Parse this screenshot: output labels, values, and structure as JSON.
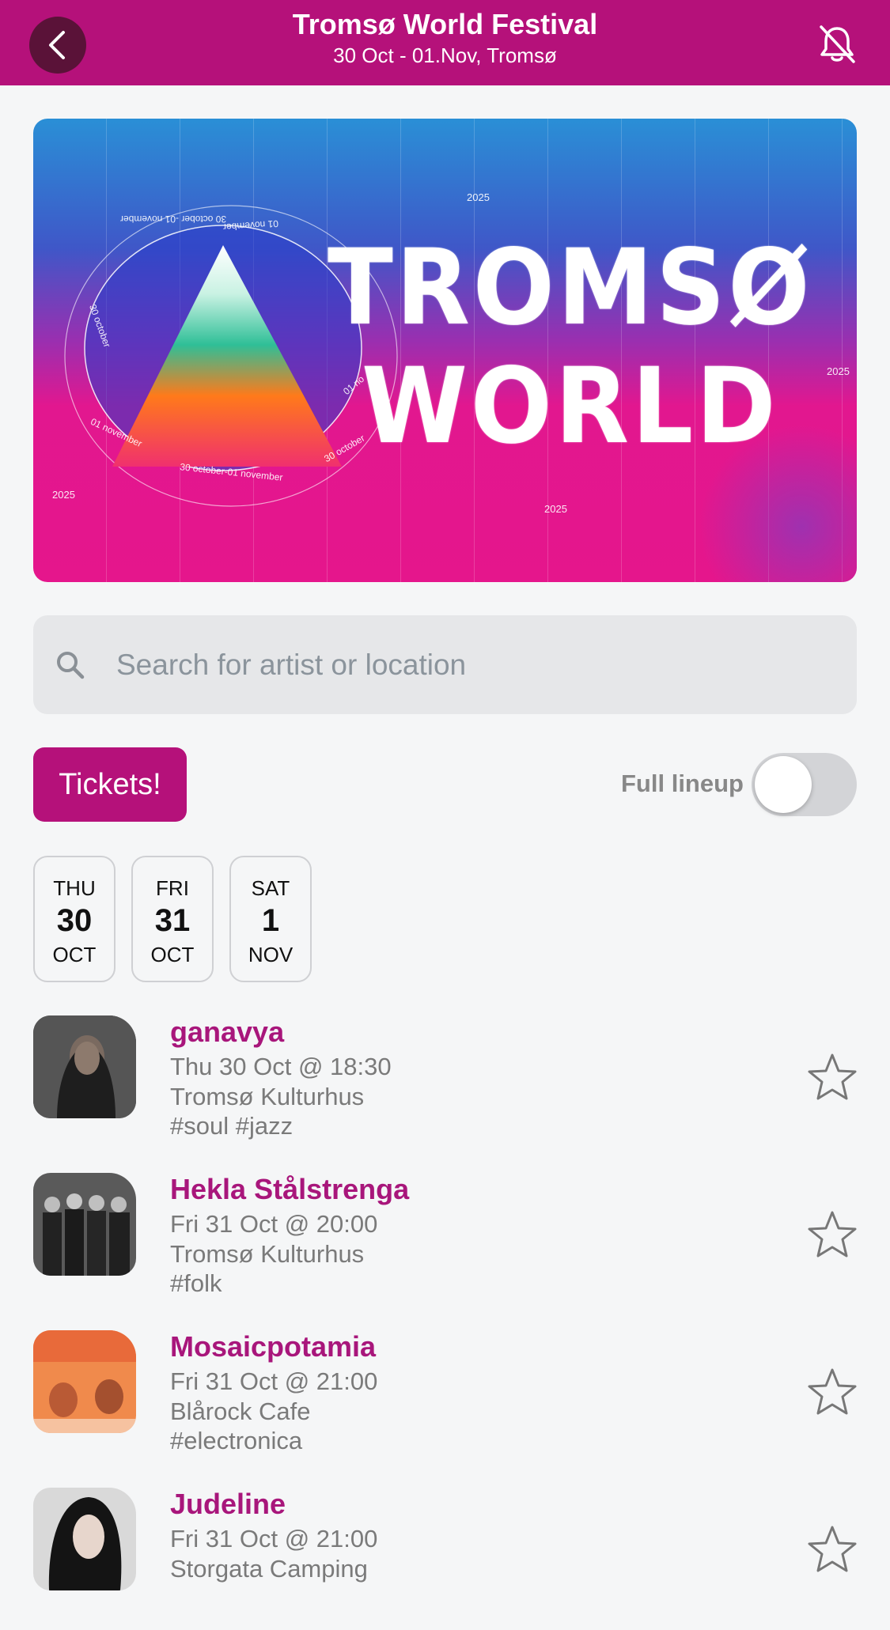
{
  "header": {
    "title": "Tromsø World Festival",
    "subtitle": "30 Oct - 01.Nov, Tromsø",
    "back_icon": "chevron-left-icon",
    "notification_icon": "bell-off-icon",
    "color": "#b5117a"
  },
  "banner": {
    "word_line1": "TROMSØ",
    "word_line2": "WORLD",
    "year_tags": [
      "2025",
      "2025",
      "2025",
      "2025"
    ],
    "ring_texts": [
      "30 october -01 november",
      "01 november",
      "30 october",
      "01 november",
      "30 october-01 november",
      "30 october",
      "01 no"
    ]
  },
  "search": {
    "placeholder": "Search for artist or location",
    "value": ""
  },
  "tickets_label": "Tickets!",
  "lineup": {
    "label": "Full lineup",
    "enabled": false
  },
  "days": [
    {
      "dow": "THU",
      "num": "30",
      "month": "OCT"
    },
    {
      "dow": "FRI",
      "num": "31",
      "month": "OCT"
    },
    {
      "dow": "SAT",
      "num": "1",
      "month": "NOV"
    }
  ],
  "events": [
    {
      "name": "ganavya",
      "time": "Thu 30 Oct @ 18:30",
      "venue": "Tromsø Kulturhus",
      "tags": "#soul #jazz"
    },
    {
      "name": "Hekla Stålstrenga",
      "time": "Fri 31 Oct @ 20:00",
      "venue": "Tromsø Kulturhus",
      "tags": "#folk"
    },
    {
      "name": "Mosaicpotamia",
      "time": "Fri 31 Oct @ 21:00",
      "venue": "Blårock Cafe",
      "tags": "#electronica"
    },
    {
      "name": "Judeline",
      "time": "Fri 31 Oct @ 21:00",
      "venue": "Storgata Camping",
      "tags": ""
    }
  ]
}
